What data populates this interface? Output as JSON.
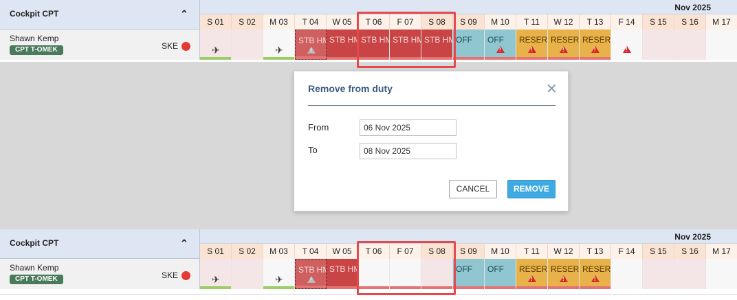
{
  "roster": {
    "group_title": "Cockpit CPT",
    "month_label": "Nov 2025",
    "crew": {
      "name": "Shawn Kemp",
      "badge": "CPT T-OMEK",
      "code": "SKE",
      "status_color": "#e53935"
    },
    "days": [
      "S 01",
      "S 02",
      "M 03",
      "T 04",
      "W 05",
      "T 06",
      "F 07",
      "S 08",
      "S 09",
      "M 10",
      "T 11",
      "W 12",
      "T 13",
      "F 14",
      "S 15",
      "S 16",
      "M 17"
    ]
  },
  "top_cells": [
    {
      "type": "empty",
      "icon": "plane-icon",
      "bar": "green"
    },
    {
      "type": "empty"
    },
    {
      "type": "white",
      "icon": "plane-icon",
      "bar": "green"
    },
    {
      "type": "stb-pale",
      "label": "STB HM",
      "icon": "warning-grey-icon",
      "bar": "red"
    },
    {
      "type": "stb",
      "label": "STB HM",
      "bar": "red"
    },
    {
      "type": "stb",
      "label": "STB HM",
      "bar": "red"
    },
    {
      "type": "stb",
      "label": "STB HM",
      "bar": "red"
    },
    {
      "type": "stb",
      "label": "STB HM",
      "bar": "red"
    },
    {
      "type": "off",
      "label": "OFF",
      "bar": "red"
    },
    {
      "type": "off",
      "label": "OFF",
      "icon": "warning-icon",
      "bar": "red"
    },
    {
      "type": "reserve",
      "label": "RESERVE",
      "icon": "warning-icon",
      "bar": "red"
    },
    {
      "type": "reserve",
      "label": "RESERVE",
      "icon": "warning-icon",
      "bar": "red"
    },
    {
      "type": "reserve",
      "label": "RESERVE",
      "icon": "warning-icon",
      "bar": "red"
    },
    {
      "type": "white",
      "icon": "warning-icon"
    },
    {
      "type": "empty"
    },
    {
      "type": "empty"
    },
    {
      "type": "white"
    }
  ],
  "bottom_cells": [
    {
      "type": "empty",
      "icon": "plane-icon",
      "bar": "green"
    },
    {
      "type": "empty"
    },
    {
      "type": "white",
      "icon": "plane-icon",
      "bar": "green"
    },
    {
      "type": "stb-pale",
      "label": "STB HM",
      "icon": "warning-grey-icon",
      "bar": "red"
    },
    {
      "type": "stb",
      "label": "STB HM",
      "bar": "red"
    },
    {
      "type": "white",
      "bar": "red"
    },
    {
      "type": "white",
      "bar": "red"
    },
    {
      "type": "empty",
      "bar": "red"
    },
    {
      "type": "off",
      "label": "OFF",
      "bar": "red"
    },
    {
      "type": "off",
      "label": "OFF",
      "bar": "red"
    },
    {
      "type": "reserve",
      "label": "RESERVE",
      "icon": "warning-icon",
      "bar": "red"
    },
    {
      "type": "reserve",
      "label": "RESERVE",
      "icon": "warning-icon",
      "bar": "red"
    },
    {
      "type": "reserve",
      "label": "RESERVE",
      "icon": "warning-icon",
      "bar": "red"
    },
    {
      "type": "white"
    },
    {
      "type": "empty"
    },
    {
      "type": "empty"
    },
    {
      "type": "white"
    }
  ],
  "dialog": {
    "title": "Remove from duty",
    "from_label": "From",
    "from_value": "06 Nov 2025",
    "to_label": "To",
    "to_value": "08 Nov 2025",
    "cancel_label": "CANCEL",
    "remove_label": "REMOVE"
  },
  "icons": {
    "collapse": "chevron-up-icon",
    "close": "close-icon",
    "plane": "plane-icon",
    "warning": "warning-icon"
  },
  "colors": {
    "stb": "#c94545",
    "off": "#8fc6cf",
    "reserve": "#e8b24a",
    "highlight": "#e5484d",
    "accent": "#3fa9e2"
  }
}
